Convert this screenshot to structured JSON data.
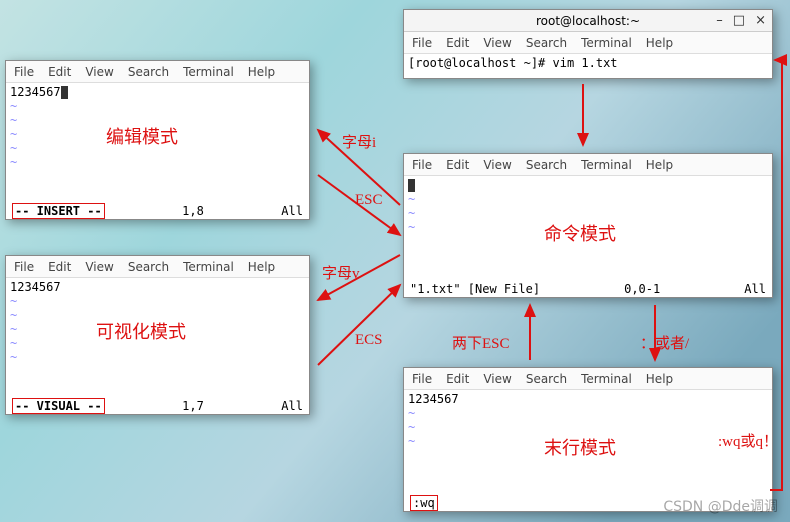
{
  "menu": {
    "file": "File",
    "edit": "Edit",
    "view": "View",
    "search": "Search",
    "terminal": "Terminal",
    "help": "Help"
  },
  "shell": {
    "title": "root@localhost:~",
    "prompt": "[root@localhost ~]# vim 1.txt"
  },
  "insert": {
    "content": "1234567",
    "mode_label": "编辑模式",
    "status_left": "-- INSERT --",
    "status_mid": "1,8",
    "status_right": "All"
  },
  "visual": {
    "content": "1234567",
    "mode_label": "可视化模式",
    "status_left": "-- VISUAL --",
    "status_mid": "1,7",
    "status_right": "All"
  },
  "command": {
    "mode_label": "命令模式",
    "status_left": "\"1.txt\" [New File]",
    "status_mid": "0,0-1",
    "status_right": "All"
  },
  "lastline": {
    "content": "1234567",
    "mode_label": "末行模式",
    "status_cmd": ":wq"
  },
  "annotations": {
    "letter_i": "字母i",
    "esc1": "ESC",
    "letter_v": "字母v",
    "ecs": "ECS",
    "double_esc": "两下ESC",
    "colon_or_slash": "：或者/",
    "wq_or_q": ":wq或q！"
  },
  "watermark": "CSDN @Dde调调"
}
